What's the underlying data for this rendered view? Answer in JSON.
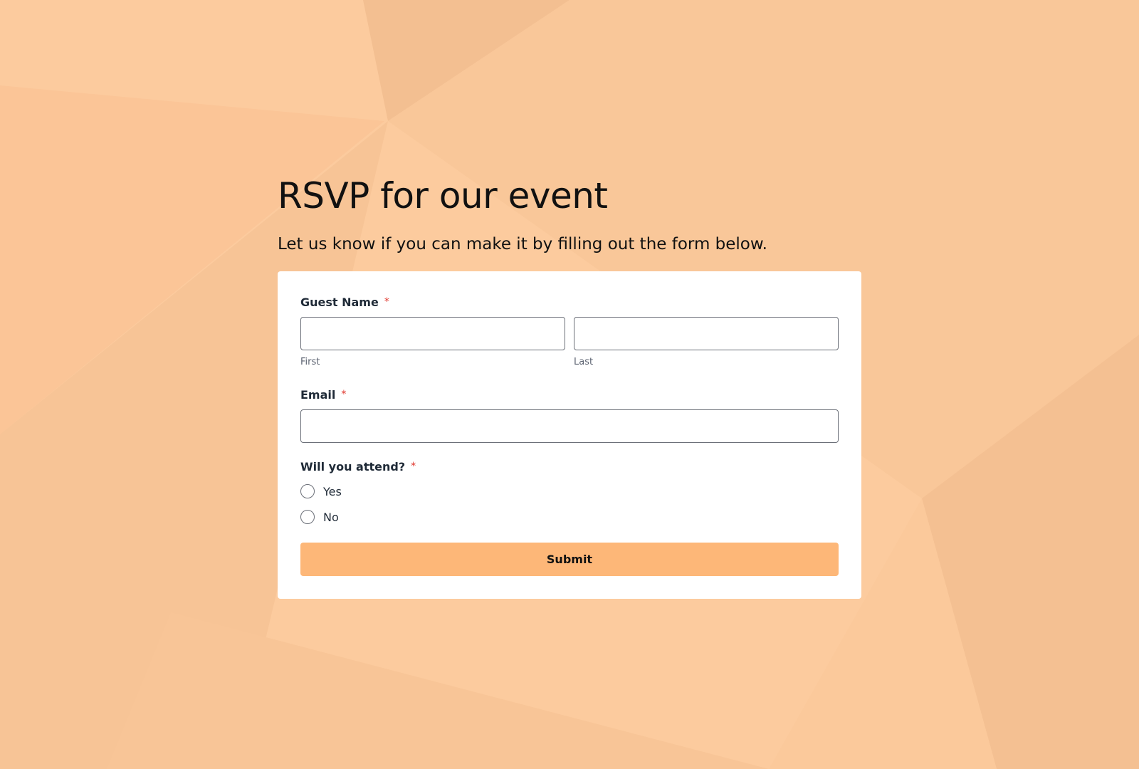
{
  "page": {
    "title": "RSVP for our event",
    "subtitle": "Let us know if you can make it by filling out the form below."
  },
  "form": {
    "guest_name": {
      "label": "Guest Name",
      "required_mark": "*",
      "first": {
        "value": "",
        "sublabel": "First"
      },
      "last": {
        "value": "",
        "sublabel": "Last"
      }
    },
    "email": {
      "label": "Email",
      "required_mark": "*",
      "value": ""
    },
    "attend": {
      "label": "Will you attend?",
      "required_mark": "*",
      "options": [
        {
          "label": "Yes",
          "selected": false
        },
        {
          "label": "No",
          "selected": false
        }
      ]
    },
    "submit_label": "Submit"
  },
  "colors": {
    "background": "#fcc99c",
    "card": "#ffffff",
    "submit_button": "#fdb778",
    "required_mark": "#e0352b"
  }
}
